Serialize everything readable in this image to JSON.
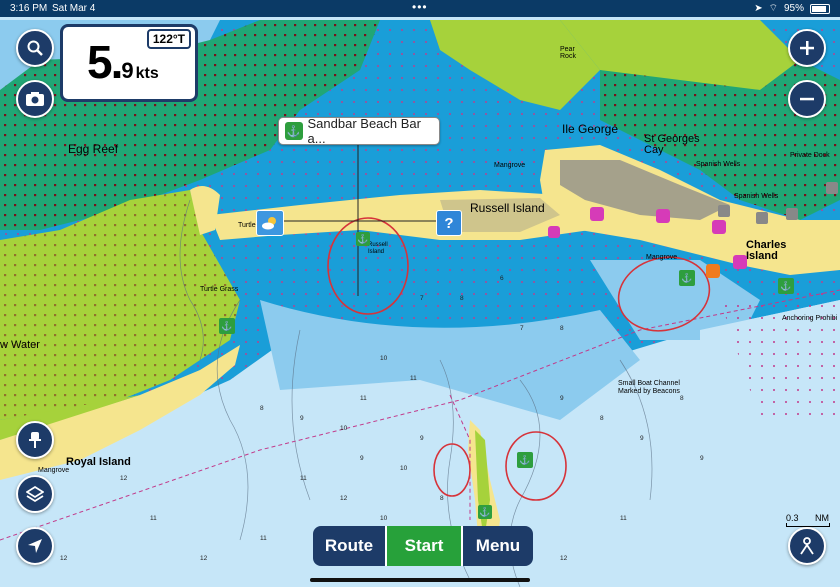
{
  "status_bar": {
    "time": "3:16 PM",
    "date": "Sat Mar 4",
    "dots": "•••",
    "battery": "95%"
  },
  "speed": {
    "whole": "5.",
    "decimal": "9",
    "unit": "kts",
    "heading": "122°T"
  },
  "callout": {
    "label": "Sandbar Beach Bar a..."
  },
  "bottom_bar": {
    "route": "Route",
    "start": "Start",
    "menu": "Menu"
  },
  "scale": {
    "value": "0.3",
    "unit": "NM"
  },
  "map_labels": {
    "egg_reef": "Egg Reef",
    "russell_island": "Russell Island",
    "ile_george": "Ile George",
    "st_georges_cay": "St Georges\nCay",
    "charles_island": "Charles\nIsland",
    "royal_island": "Royal Island",
    "w_water": "w Water",
    "pear_rock": "Pear\nRock",
    "mangrove1": "Mangrove",
    "mangrove2": "Mangrove",
    "mangrove3": "Mangrove",
    "turtle": "Turtle",
    "turtle_grass": "Turtle Grass",
    "spanish_wells1": "Spanish Wells",
    "spanish_wells2": "Spanish Wells",
    "private_dock": "Private Dock",
    "anchoring_prohibited": "Anchoring Prohibi",
    "small_boat_channel": "Small Boat Channel\nMarked by Beacons",
    "russell_island_small": "Russell\nIsland"
  },
  "colors": {
    "land": "#f5e58e",
    "shoal": "#1a9ed8",
    "mangrove": "#21a675",
    "green_land": "#a6d23b",
    "deep": "#c6e6f8",
    "nav": "#1d3b68",
    "start_green": "#27a13a",
    "annotation_red": "#d6333a"
  },
  "icons": [
    "search-icon",
    "camera-icon",
    "zoom-in-icon",
    "zoom-out-icon",
    "pin-icon",
    "layers-icon",
    "location-arrow-icon",
    "person-icon",
    "weather-icon",
    "question-icon",
    "anchorage-icon",
    "marina-icon"
  ]
}
